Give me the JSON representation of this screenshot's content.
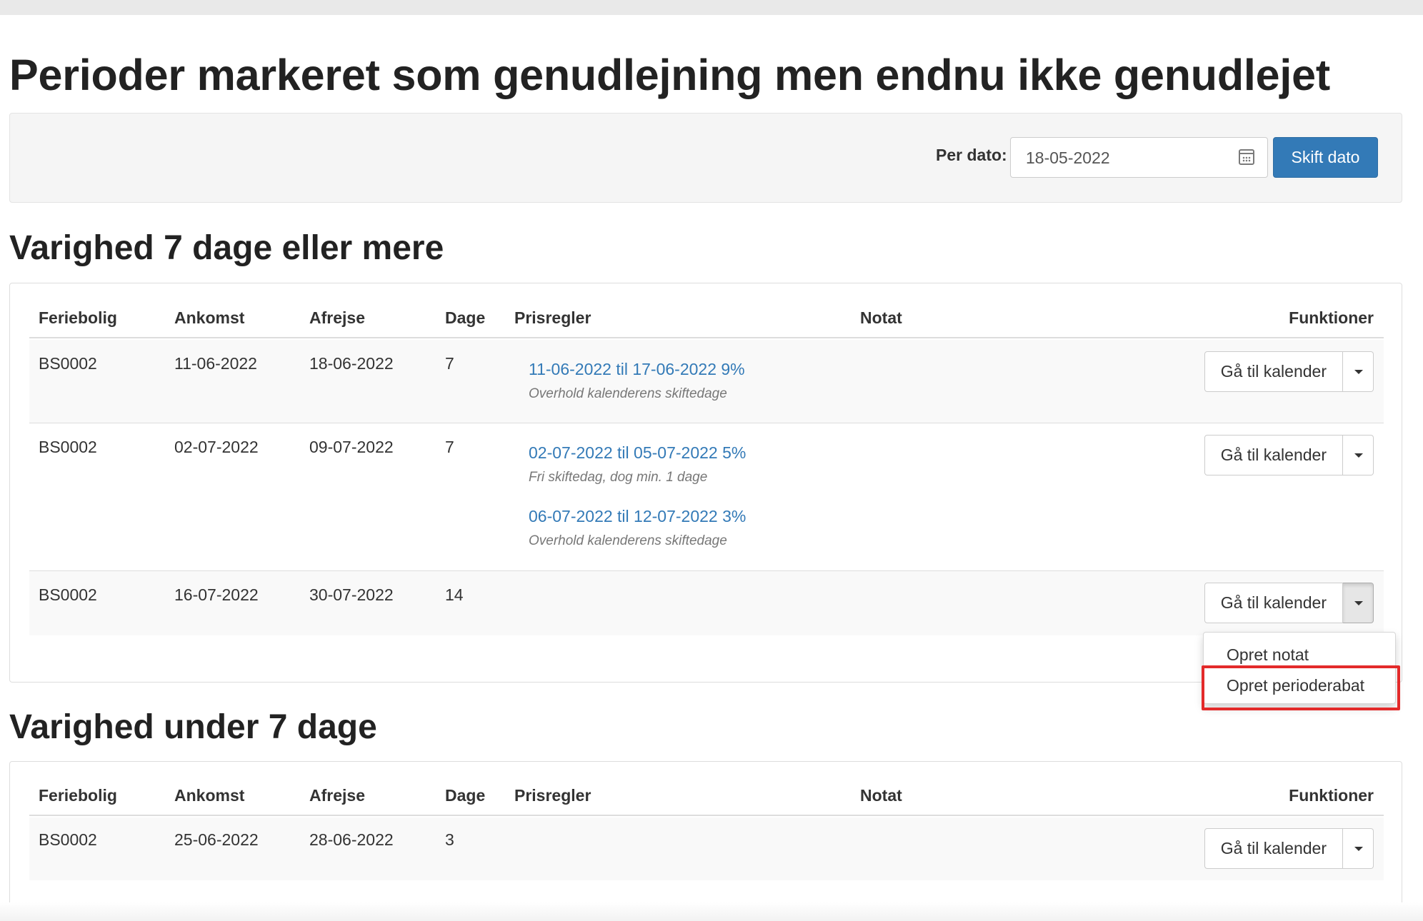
{
  "page": {
    "title": "Perioder markeret som genudlejning men endnu ikke genudlejet"
  },
  "filter": {
    "label": "Per dato:",
    "date_value": "18-05-2022",
    "calendar_icon": "calendar-icon",
    "submit_label": "Skift dato"
  },
  "columns": [
    "Feriebolig",
    "Ankomst",
    "Afrejse",
    "Dage",
    "Prisregler",
    "Notat",
    "Funktioner"
  ],
  "section_long": {
    "title": "Varighed 7 dage eller mere",
    "rows": [
      {
        "property": "BS0002",
        "arrival": "11-06-2022",
        "departure": "18-06-2022",
        "days": "7",
        "rules": [
          {
            "link": "11-06-2022 til 17-06-2022 9%",
            "note": "Overhold kalenderens skiftedage"
          }
        ],
        "button": "Gå til kalender"
      },
      {
        "property": "BS0002",
        "arrival": "02-07-2022",
        "departure": "09-07-2022",
        "days": "7",
        "rules": [
          {
            "link": "02-07-2022 til 05-07-2022 5%",
            "note": "Fri skiftedag, dog min. 1 dage"
          },
          {
            "link": "06-07-2022 til 12-07-2022 3%",
            "note": "Overhold kalenderens skiftedage"
          }
        ],
        "button": "Gå til kalender"
      },
      {
        "property": "BS0002",
        "arrival": "16-07-2022",
        "departure": "30-07-2022",
        "days": "14",
        "rules": [],
        "button": "Gå til kalender"
      }
    ]
  },
  "dropdown_menu": {
    "items": [
      "Opret notat",
      "Opret perioderabat"
    ],
    "highlight_color": "#e32a2a"
  },
  "section_short": {
    "title": "Varighed under 7 dage",
    "rows": [
      {
        "property": "BS0002",
        "arrival": "25-06-2022",
        "departure": "28-06-2022",
        "days": "3",
        "rules": [],
        "button": "Gå til kalender"
      }
    ]
  },
  "colors": {
    "primary": "#337ab7",
    "link": "#337ab7",
    "border": "#dddddd"
  }
}
